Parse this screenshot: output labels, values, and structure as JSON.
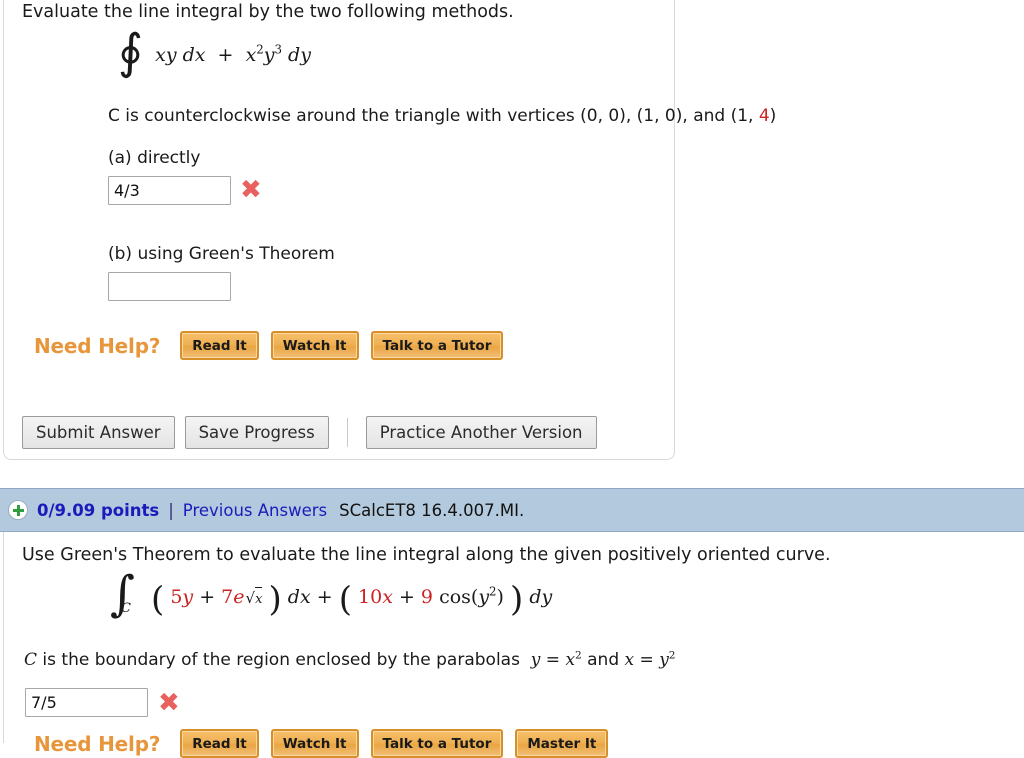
{
  "question1": {
    "prompt": "Evaluate the line integral by the two following methods.",
    "integral": {
      "symbol": "∮",
      "integrand_1": "xy dx",
      "plus": "+",
      "integrand_2": "x²y³ dy"
    },
    "condition": "C is counterclockwise around the triangle with vertices (0, 0), (1, 0), and (1, ",
    "condition_red_value": "4",
    "condition_tail": ")",
    "parts": [
      {
        "label": "(a) directly",
        "value": "4/3",
        "status": "incorrect",
        "status_icon": "x-mark"
      },
      {
        "label": "(b) using Green's Theorem",
        "value": "",
        "status": "unanswered",
        "status_icon": ""
      }
    ],
    "need_help": {
      "label": "Need Help?",
      "buttons": [
        "Read It",
        "Watch It",
        "Talk to a Tutor"
      ]
    },
    "actions": {
      "submit": "Submit Answer",
      "save": "Save Progress",
      "practice": "Practice Another Version"
    }
  },
  "points_bar": {
    "plus_icon": "plus-circle-icon",
    "points": "0/9.09 points",
    "separator": "|",
    "previous_answers": "Previous Answers",
    "question_code": "SCalcET8 16.4.007.MI."
  },
  "question2": {
    "prompt": "Use Green's Theorem to evaluate the line integral along the given positively oriented curve.",
    "integral": {
      "symbol": "∫",
      "subscript": "C",
      "coef_5": "5",
      "term_y": "y",
      "plus1": "+",
      "coef_7": "7",
      "exp_base": "e",
      "sqrt": "√",
      "sqrt_arg": "x",
      "dx": "dx",
      "plus2": "+",
      "coef_10": "10",
      "term_x": "x",
      "plus3": "+",
      "coef_9": "9",
      "cos": "cos(y²)",
      "dy": "dy"
    },
    "condition_pre": "C is the boundary of the region enclosed by the parabolas ",
    "condition_eq1": "y = x²",
    "condition_mid": " and ",
    "condition_eq2": "x = y²",
    "answer": {
      "value": "7/5",
      "status": "incorrect",
      "status_icon": "x-mark"
    },
    "need_help": {
      "label": "Need Help?",
      "buttons": [
        "Read It",
        "Watch It",
        "Talk to a Tutor",
        "Master It"
      ]
    }
  },
  "colors": {
    "points_bar_bg": "#b3c9de",
    "link_blue": "#1b1bbb",
    "need_help_orange": "#e8963c",
    "help_button_orange": "#efb155",
    "error_red": "#e8615e",
    "math_red": "#cc2222"
  }
}
